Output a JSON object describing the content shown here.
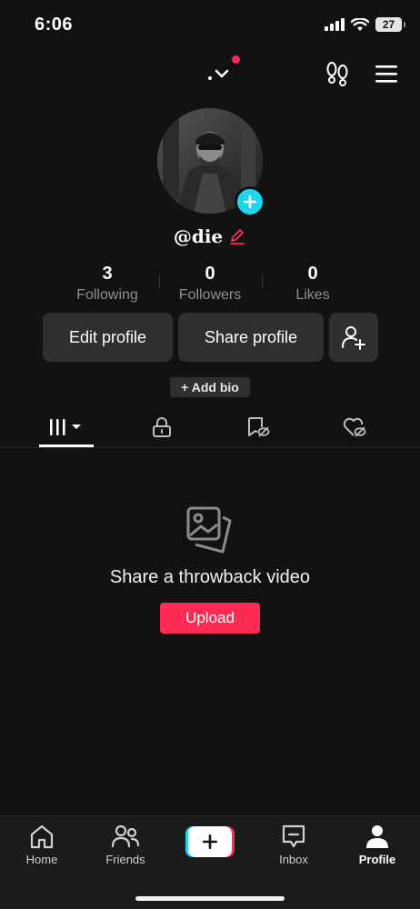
{
  "status_bar": {
    "time": "6:06",
    "battery": "27"
  },
  "profile": {
    "username": "@die",
    "stats": [
      {
        "value": "3",
        "label": "Following"
      },
      {
        "value": "0",
        "label": "Followers"
      },
      {
        "value": "0",
        "label": "Likes"
      }
    ],
    "edit_profile_label": "Edit profile",
    "share_profile_label": "Share profile",
    "add_bio_label": "+ Add bio"
  },
  "empty_state": {
    "title": "Share a throwback video",
    "upload_label": "Upload"
  },
  "bottom_nav": {
    "items": [
      {
        "label": "Home",
        "icon": "home-icon"
      },
      {
        "label": "Friends",
        "icon": "friends-icon"
      },
      {
        "label": "",
        "icon": "create-icon"
      },
      {
        "label": "Inbox",
        "icon": "inbox-icon"
      },
      {
        "label": "Profile",
        "icon": "profile-icon"
      }
    ],
    "active": "Profile"
  },
  "colors": {
    "background": "#121212",
    "accent_red": "#fe2c55",
    "accent_cyan": "#20d5ec",
    "button_bg": "#2f2f2f"
  }
}
